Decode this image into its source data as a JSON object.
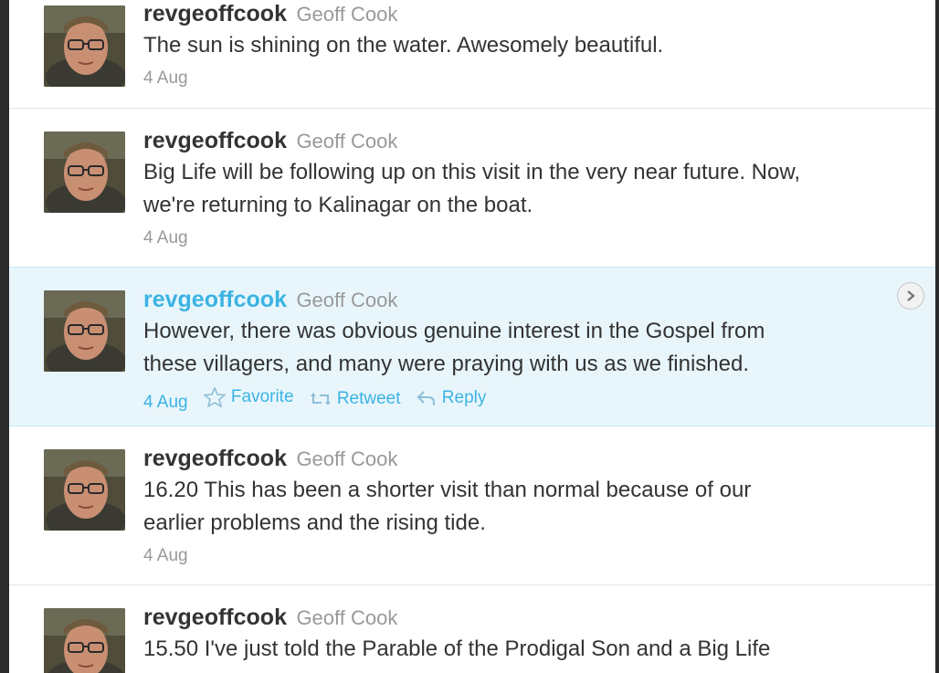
{
  "tweets": [
    {
      "screen_name": "revgeoffcook",
      "full_name": "Geoff Cook",
      "text_lines": [
        "The sun is shining on the water. Awesomely beautiful."
      ],
      "date": "4 Aug"
    },
    {
      "screen_name": "revgeoffcook",
      "full_name": "Geoff Cook",
      "text_lines": [
        "Big Life will be following up on this visit in the very near future. Now,",
        "we're returning to Kalinagar on the boat."
      ],
      "date": "4 Aug"
    },
    {
      "screen_name": "revgeoffcook",
      "full_name": "Geoff Cook",
      "text_lines": [
        "However, there was obvious genuine interest in the Gospel from",
        "these villagers, and many were praying with us as we finished."
      ],
      "date": "4 Aug",
      "actions": {
        "favorite": "Favorite",
        "retweet": "Retweet",
        "reply": "Reply"
      }
    },
    {
      "screen_name": "revgeoffcook",
      "full_name": "Geoff Cook",
      "text_lines": [
        "16.20 This has been a shorter visit than normal because of our",
        "earlier problems and the rising tide."
      ],
      "date": "4 Aug"
    },
    {
      "screen_name": "revgeoffcook",
      "full_name": "Geoff Cook",
      "text_lines": [
        "15.50 I've just told the Parable of the Prodigal Son and a Big Life"
      ]
    }
  ],
  "icons": {
    "favorite": "star-icon",
    "retweet": "retweet-icon",
    "reply": "reply-icon",
    "details": "chevron-right-icon"
  },
  "colors": {
    "link_blue": "#3bb3e3",
    "hover_background": "#e8f6fc",
    "text": "#333333",
    "muted": "#999999"
  }
}
